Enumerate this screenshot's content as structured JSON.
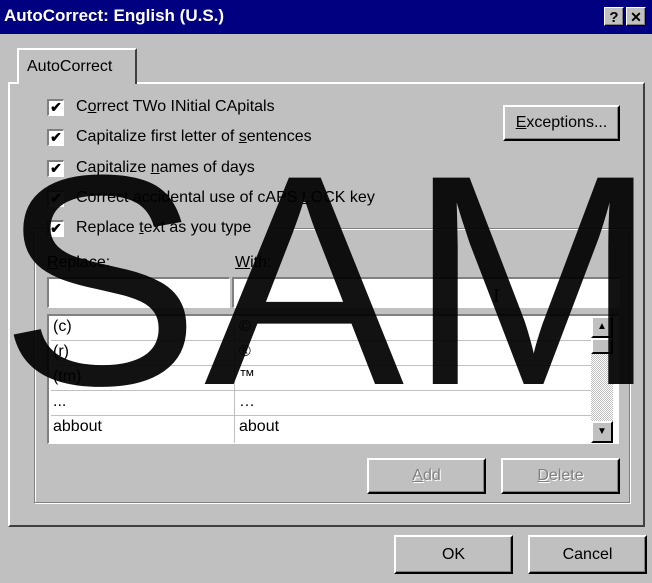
{
  "window": {
    "title": "AutoCorrect: English (U.S.)",
    "help_glyph": "?",
    "close_glyph": "✕"
  },
  "tabs": [
    {
      "label": "AutoCorrect",
      "selected": true
    }
  ],
  "options": [
    {
      "pre": "C",
      "u": "o",
      "post": "rrect TWo INitial CApitals",
      "checked": true
    },
    {
      "pre": "Capitalize first letter of ",
      "u": "s",
      "post": "entences",
      "checked": true
    },
    {
      "pre": "Capitalize ",
      "u": "n",
      "post": "ames of days",
      "checked": true
    },
    {
      "pre": "Correct accidental use of cAPS ",
      "u": "L",
      "post": "OCK key",
      "checked": true
    },
    {
      "pre": "Replace ",
      "u": "t",
      "post": "ext as you type",
      "checked": true
    }
  ],
  "exceptions_button": {
    "u": "E",
    "post": "xceptions..."
  },
  "replace": {
    "replace_label": {
      "u": "R",
      "post": "eplace:"
    },
    "with_label": {
      "u": "W",
      "post": "ith:"
    },
    "replace_value": "",
    "with_value": "",
    "rows": [
      {
        "replace": "(c)",
        "with": "©"
      },
      {
        "replace": "(r)",
        "with": "®"
      },
      {
        "replace": "(tm)",
        "with": "™"
      },
      {
        "replace": "...",
        "with": "…"
      },
      {
        "replace": "abbout",
        "with": "about"
      }
    ]
  },
  "buttons": {
    "add": {
      "u": "A",
      "post": "dd",
      "enabled": false
    },
    "delete": {
      "u": "D",
      "post": "elete",
      "enabled": false
    },
    "ok": "OK",
    "cancel": "Cancel"
  },
  "watermark": "SAM",
  "colors": {
    "titlebar": "#000080",
    "face": "#c0c0c0"
  }
}
